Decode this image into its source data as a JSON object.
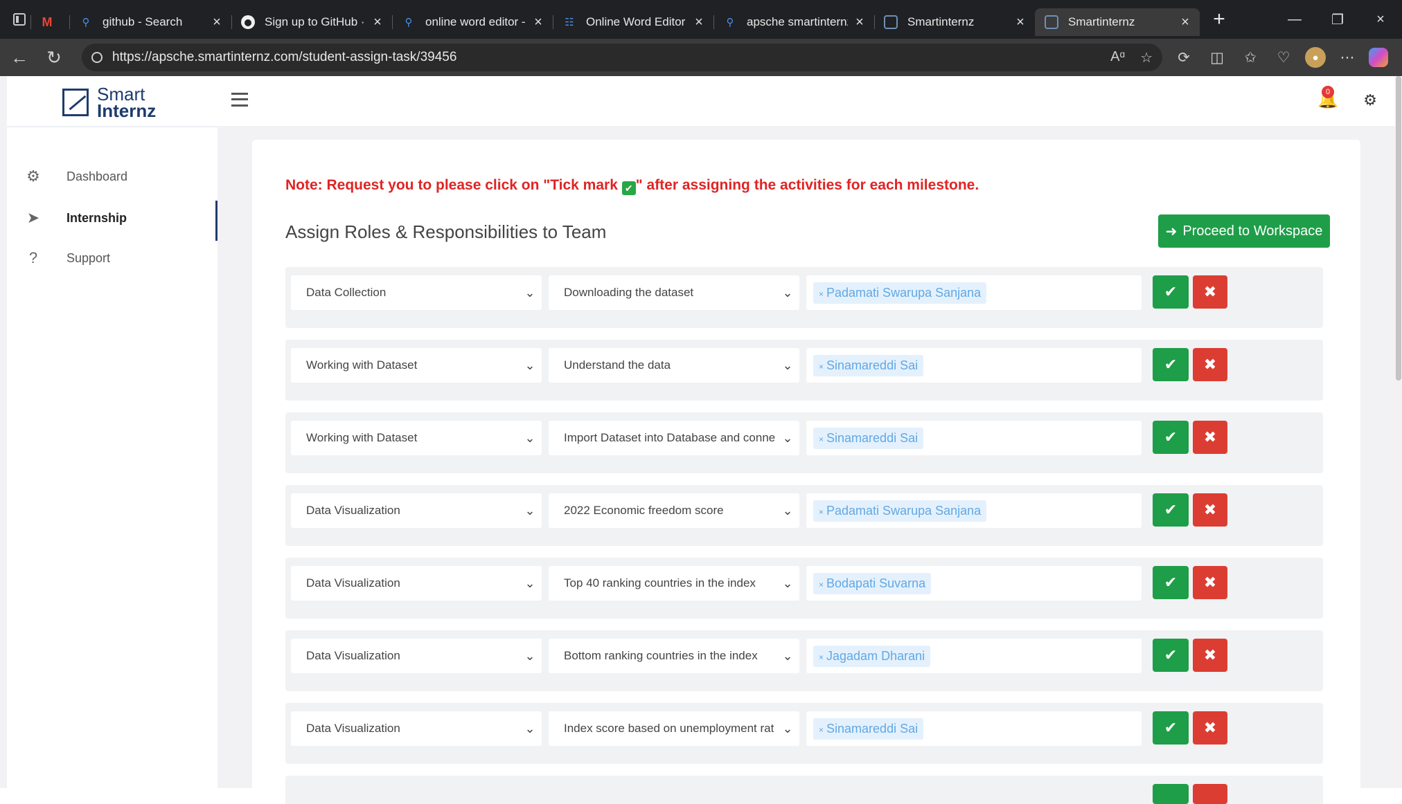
{
  "browser": {
    "tabs": [
      {
        "title": "",
        "favicon": "gmail-icon"
      },
      {
        "title": "github - Search",
        "favicon": "search-icon"
      },
      {
        "title": "Sign up to GitHub · G",
        "favicon": "github-icon"
      },
      {
        "title": "online word editor - S",
        "favicon": "search-icon"
      },
      {
        "title": "Online Word Editor | ",
        "favicon": "word-editor-icon"
      },
      {
        "title": "apsche smartinternz ",
        "favicon": "search-icon"
      },
      {
        "title": "Smartinternz",
        "favicon": "smartinternz-icon"
      },
      {
        "title": "Smartinternz",
        "favicon": "smartinternz-icon",
        "active": true
      }
    ],
    "url": "https://apsche.smartinternz.com/student-assign-task/39456"
  },
  "sidebar": {
    "logo": {
      "line1": "Smart",
      "line2": "Internz"
    },
    "items": [
      {
        "label": "Dashboard",
        "icon": "dashboard-icon"
      },
      {
        "label": "Internship",
        "icon": "paper-plane-icon",
        "active": true
      },
      {
        "label": "Support",
        "icon": "question-icon"
      }
    ]
  },
  "topbar": {
    "notification_count": "0"
  },
  "main": {
    "note_before": "Note: Request you to please click on \"Tick mark ",
    "note_after": "\" after assigning the activities for each milestone.",
    "title": "Assign Roles & Responsibilities to Team",
    "proceed_label": "Proceed to Workspace",
    "rows": [
      {
        "milestone": "Data Collection",
        "activity": "Downloading the dataset",
        "assignee": "Padamati Swarupa Sanjana"
      },
      {
        "milestone": "Working with Dataset",
        "activity": "Understand the data",
        "assignee": "Sinamareddi Sai"
      },
      {
        "milestone": "Working with Dataset",
        "activity": "Import Dataset into Database and conne",
        "assignee": "Sinamareddi Sai"
      },
      {
        "milestone": "Data Visualization",
        "activity": "2022 Economic freedom score",
        "assignee": "Padamati Swarupa Sanjana"
      },
      {
        "milestone": "Data Visualization",
        "activity": "Top 40 ranking countries in the index",
        "assignee": "Bodapati Suvarna"
      },
      {
        "milestone": "Data Visualization",
        "activity": "Bottom ranking countries in the index",
        "assignee": "Jagadam Dharani"
      },
      {
        "milestone": "Data Visualization",
        "activity": "Index score based on unemployment rat",
        "assignee": "Sinamareddi Sai"
      }
    ]
  },
  "colors": {
    "accent_green": "#1e9e48",
    "danger_red": "#dc3d32",
    "note_red": "#e02424",
    "brand_navy": "#1e3b6e",
    "tag_blue": "#62a8e3"
  }
}
